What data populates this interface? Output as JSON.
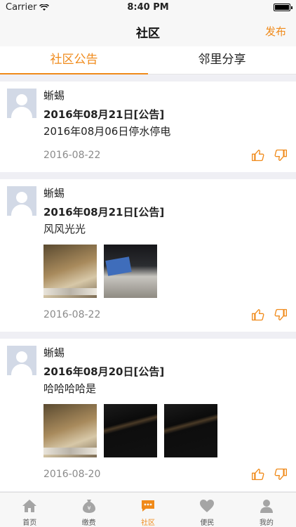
{
  "status_bar": {
    "carrier": "Carrier",
    "time": "8:40 PM"
  },
  "nav": {
    "title": "社区",
    "action": "发布"
  },
  "tabs": [
    {
      "label": "社区公告",
      "active": true
    },
    {
      "label": "邻里分享",
      "active": false
    }
  ],
  "posts": [
    {
      "user": "蜥蜴",
      "title": "2016年08月21日[公告]",
      "body": "2016年08月06日停水停电",
      "date": "2016-08-22",
      "photos": []
    },
    {
      "user": "蜥蜴",
      "title": "2016年08月21日[公告]",
      "body": "风风光光",
      "date": "2016-08-22",
      "photos": [
        "desk-photo",
        "box-photo"
      ]
    },
    {
      "user": "蜥蜴",
      "title": "2016年08月20日[公告]",
      "body": "哈哈哈哈是",
      "date": "2016-08-20",
      "photos": [
        "desk-photo",
        "dark-photo",
        "dark-photo"
      ]
    }
  ],
  "tab_bar": [
    {
      "label": "首页",
      "icon": "home-icon",
      "active": false
    },
    {
      "label": "缴费",
      "icon": "money-bag-icon",
      "active": false
    },
    {
      "label": "社区",
      "icon": "chat-icon",
      "active": true
    },
    {
      "label": "便民",
      "icon": "heart-icon",
      "active": false
    },
    {
      "label": "我的",
      "icon": "person-icon",
      "active": false
    }
  ],
  "colors": {
    "accent": "#f08a1a",
    "icon_gray": "#a5a5a5"
  }
}
